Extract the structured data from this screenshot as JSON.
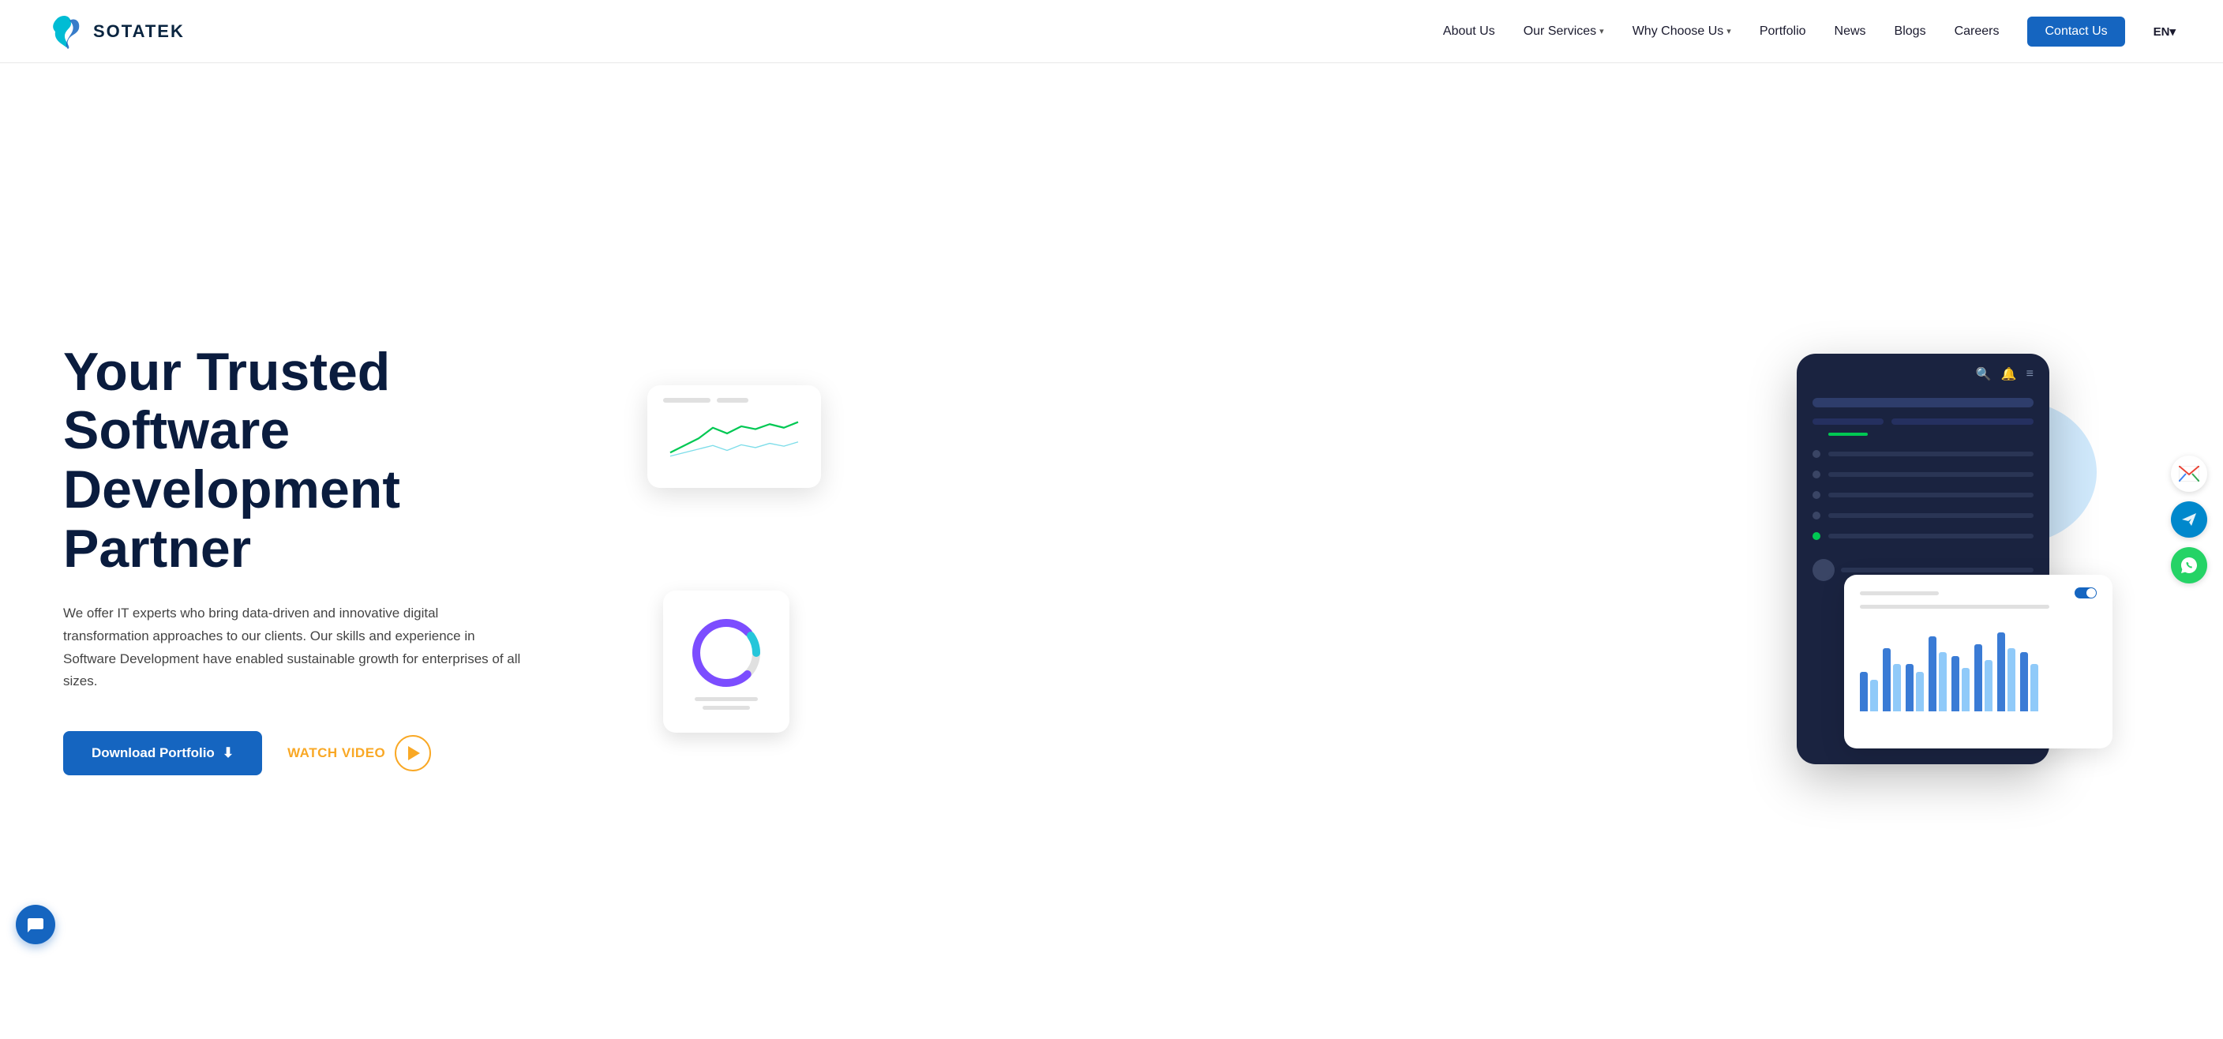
{
  "header": {
    "logo_text": "SOTATEK",
    "nav_items": [
      {
        "label": "About Us",
        "has_dropdown": false
      },
      {
        "label": "Our Services",
        "has_dropdown": true
      },
      {
        "label": "Why Choose Us",
        "has_dropdown": true
      },
      {
        "label": "Portfolio",
        "has_dropdown": false
      },
      {
        "label": "News",
        "has_dropdown": false
      },
      {
        "label": "Blogs",
        "has_dropdown": false
      },
      {
        "label": "Careers",
        "has_dropdown": false
      }
    ],
    "contact_label": "Contact Us",
    "lang_label": "EN"
  },
  "hero": {
    "title_line1": "Your Trusted Software",
    "title_line2": "Development Partner",
    "description": "We offer IT experts who bring data-driven and innovative digital transformation approaches to our clients. Our skills and experience in Software Development have enabled sustainable growth for enterprises of all sizes.",
    "btn_download": "Download Portfolio",
    "btn_watch": "WATCH VIDEO"
  },
  "float_icons": {
    "gmail": "M",
    "telegram": "✈",
    "whatsapp": "✆"
  }
}
